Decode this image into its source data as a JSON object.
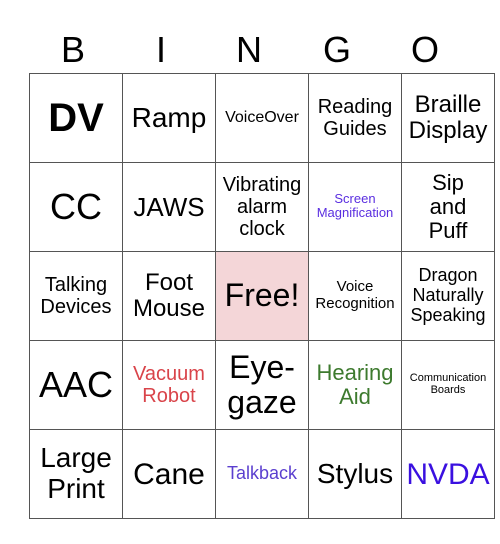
{
  "header": {
    "letters": [
      "B",
      "I",
      "N",
      "G",
      "O"
    ]
  },
  "colors": {
    "free_bg": "#f4d6d8",
    "red": "#d9444a",
    "green": "#3d7a2e",
    "purple": "#5b3fcf",
    "blue": "#3a10e0",
    "violet": "#5a2ee0"
  },
  "rows": [
    [
      {
        "text": "DV",
        "size": "xl-bold"
      },
      {
        "text": "Ramp"
      },
      {
        "text": "VoiceOver"
      },
      {
        "text": "Reading\nGuides"
      },
      {
        "text": "Braille\nDisplay"
      }
    ],
    [
      {
        "text": "CC"
      },
      {
        "text": "JAWS"
      },
      {
        "text": "Vibrating\nalarm\nclock"
      },
      {
        "text": "Screen\nMagnification",
        "color": "violet"
      },
      {
        "text": "Sip\nand\nPuff"
      }
    ],
    [
      {
        "text": "Talking\nDevices"
      },
      {
        "text": "Foot\nMouse"
      },
      {
        "text": "Free!",
        "free": true
      },
      {
        "text": "Voice\nRecognition"
      },
      {
        "text": "Dragon\nNaturally\nSpeaking"
      }
    ],
    [
      {
        "text": "AAC"
      },
      {
        "text": "Vacuum\nRobot",
        "color": "red"
      },
      {
        "text": "Eye-\ngaze"
      },
      {
        "text": "Hearing\nAid",
        "color": "green"
      },
      {
        "text": "Communication\nBoards"
      }
    ],
    [
      {
        "text": "Large\nPrint"
      },
      {
        "text": "Cane"
      },
      {
        "text": "Talkback",
        "color": "purple"
      },
      {
        "text": "Stylus"
      },
      {
        "text": "NVDA",
        "color": "blue"
      }
    ]
  ]
}
